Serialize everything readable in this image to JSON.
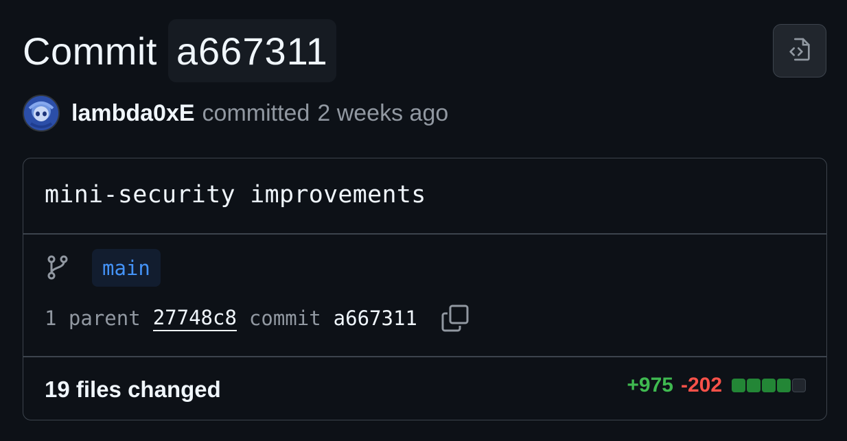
{
  "header": {
    "title_word": "Commit",
    "short_sha": "a667311",
    "browse_files_icon": "file-code-icon"
  },
  "author": {
    "avatar_icon": "avatar",
    "name": "lambda0xE",
    "verb": "committed",
    "time": "2 weeks ago"
  },
  "commit": {
    "message": "mini-security improvements",
    "branch_icon": "git-branch-icon",
    "branch": "main",
    "parent_count_label": "1 parent",
    "parent_sha": "27748c8",
    "commit_label": "commit",
    "commit_sha": "a667311",
    "copy_icon": "copy-icon"
  },
  "diff_summary": {
    "files_changed": "19 files changed",
    "additions": "+975",
    "deletions": "-202",
    "blocks": [
      "add",
      "add",
      "add",
      "add",
      "neutral"
    ]
  },
  "colors": {
    "background": "#0d1117",
    "border": "#3d444d",
    "addition": "#3fb950",
    "deletion": "#f85149",
    "link_blue": "#4493f8"
  }
}
